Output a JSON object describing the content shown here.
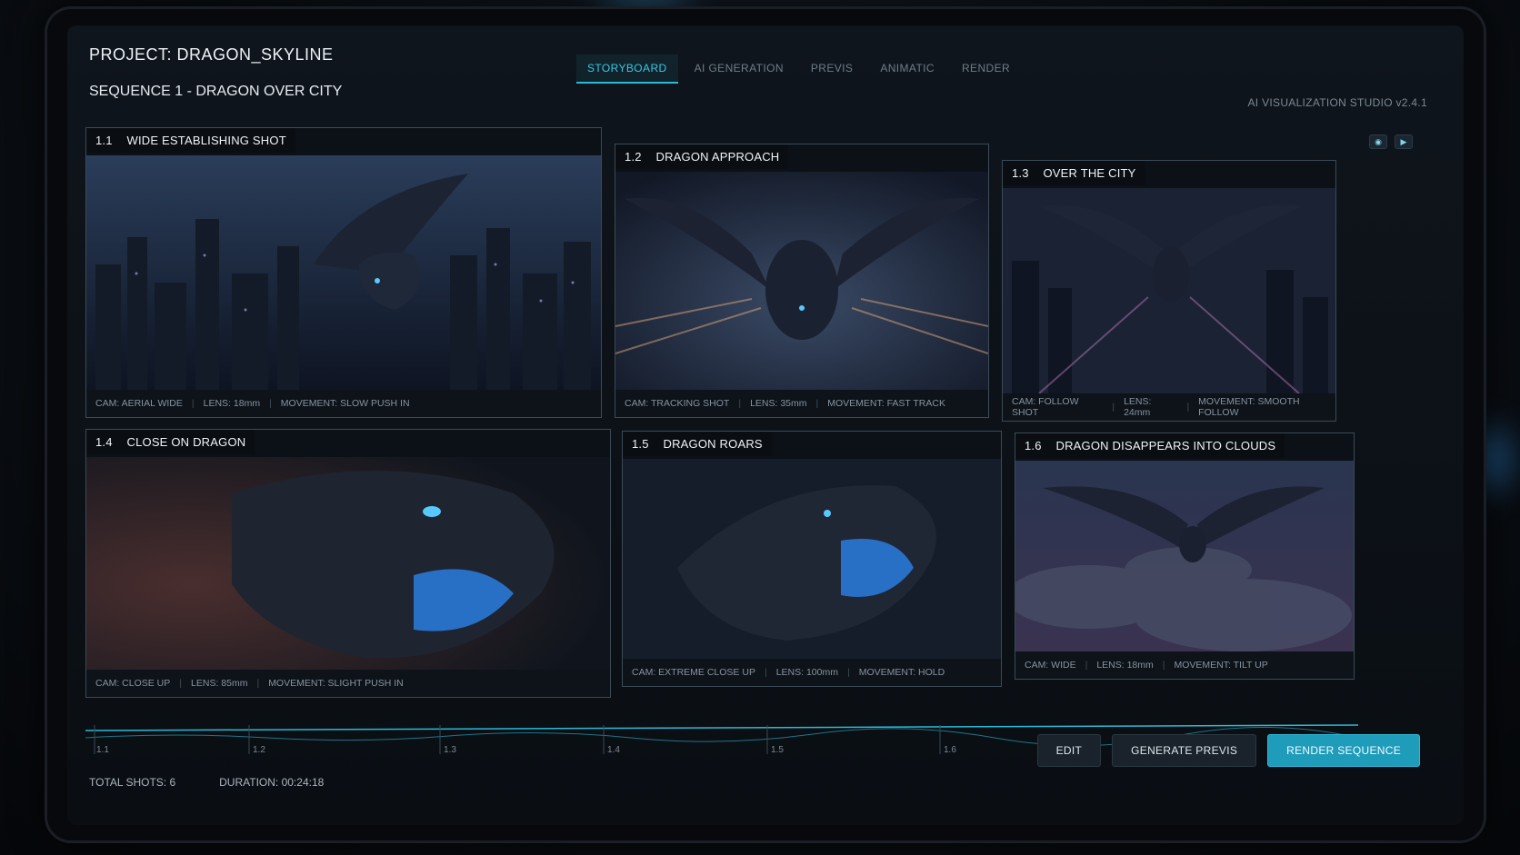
{
  "header": {
    "project": "PROJECT: DRAGON_SKYLINE",
    "sequence": "SEQUENCE 1 - DRAGON OVER CITY",
    "studio_version": "AI VISUALIZATION STUDIO v2.4.1"
  },
  "tabs": [
    {
      "label": "STORYBOARD",
      "active": true
    },
    {
      "label": "AI GENERATION",
      "active": false
    },
    {
      "label": "PREVIS",
      "active": false
    },
    {
      "label": "ANIMATIC",
      "active": false
    },
    {
      "label": "RENDER",
      "active": false
    }
  ],
  "shots": [
    {
      "num": "1.1",
      "title": "WIDE ESTABLISHING SHOT",
      "cam": "CAM: AERIAL WIDE",
      "lens": "LENS: 18mm",
      "movement": "MOVEMENT: SLOW PUSH IN"
    },
    {
      "num": "1.2",
      "title": "DRAGON APPROACH",
      "cam": "CAM: TRACKING SHOT",
      "lens": "LENS: 35mm",
      "movement": "MOVEMENT: FAST TRACK"
    },
    {
      "num": "1.3",
      "title": "OVER THE CITY",
      "cam": "CAM: FOLLOW SHOT",
      "lens": "LENS: 24mm",
      "movement": "MOVEMENT: SMOOTH FOLLOW"
    },
    {
      "num": "1.4",
      "title": "CLOSE ON DRAGON",
      "cam": "CAM: CLOSE UP",
      "lens": "LENS: 85mm",
      "movement": "MOVEMENT: SLIGHT PUSH IN"
    },
    {
      "num": "1.5",
      "title": "DRAGON ROARS",
      "cam": "CAM: EXTREME CLOSE UP",
      "lens": "LENS: 100mm",
      "movement": "MOVEMENT: HOLD"
    },
    {
      "num": "1.6",
      "title": "DRAGON DISAPPEARS INTO CLOUDS",
      "cam": "CAM: WIDE",
      "lens": "LENS: 18mm",
      "movement": "MOVEMENT: TILT UP"
    }
  ],
  "timeline": {
    "ticks": [
      "1.1",
      "1.2",
      "1.3",
      "1.4",
      "1.5",
      "1.6"
    ]
  },
  "actions": {
    "edit": "EDIT",
    "generate_previs": "GENERATE PREVIS",
    "render_sequence": "RENDER SEQUENCE"
  },
  "footer": {
    "total_shots": "TOTAL SHOTS: 6",
    "duration": "DURATION: 00:24:18"
  },
  "colors": {
    "accent": "#2bb9d8",
    "background": "#0c1117",
    "panel_border": "#3c4a56"
  },
  "icons": {
    "view_toggle": "eye-icon",
    "play": "play-icon"
  }
}
